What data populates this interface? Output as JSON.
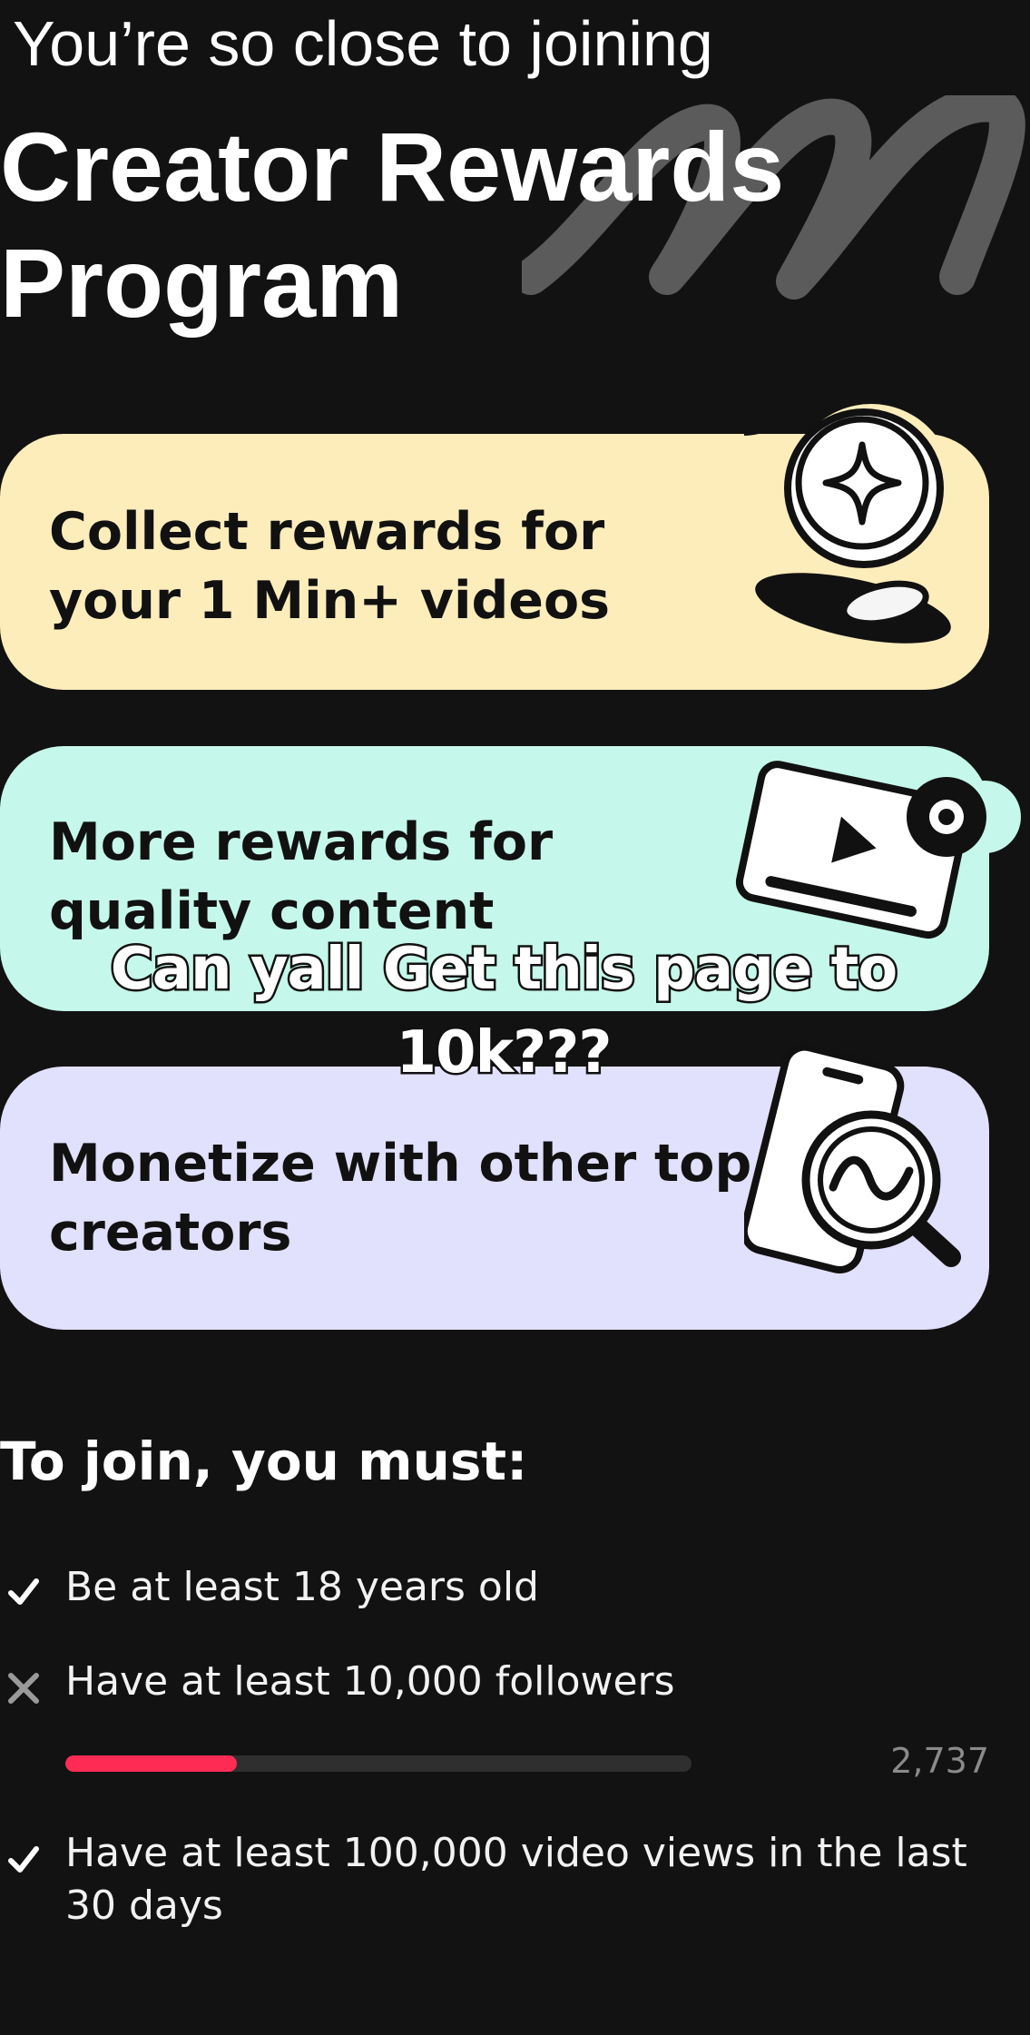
{
  "header": {
    "subtitle": "You’re so close to joining",
    "title_line1": "Creator Rewards",
    "title_line2": "Program"
  },
  "cards": [
    {
      "line1": "Collect rewards for",
      "line2": "your 1 Min+ videos",
      "bg": "#fdedbb",
      "icon": "coin-icon"
    },
    {
      "line1": "More rewards for",
      "line2": "quality content",
      "bg": "#c5f8ea",
      "icon": "video-play-icon"
    },
    {
      "line1": "Monetize with other top",
      "line2": "creators",
      "bg": "#e1e0fd",
      "icon": "phone-search-icon"
    }
  ],
  "overlay_caption": {
    "line1": "Can yall Get this page to",
    "line2": "10k???"
  },
  "requirements": {
    "heading": "To join, you must:",
    "items": [
      {
        "status": "met",
        "icon": "check-icon",
        "line1": "Be at least 18 years old"
      },
      {
        "status": "unmet",
        "icon": "x-icon",
        "line1": "Have at least 10,000 followers"
      },
      {
        "status": "met",
        "icon": "check-icon",
        "line1": "Have at least 100,000 video views in the last",
        "line2": "30 days"
      }
    ],
    "followers_progress": {
      "current_display": "2,737",
      "current": 2737,
      "target": 10000
    }
  },
  "colors": {
    "background": "#121212",
    "progress_fill": "#fe2c55",
    "progress_track": "#2f2f2f"
  }
}
